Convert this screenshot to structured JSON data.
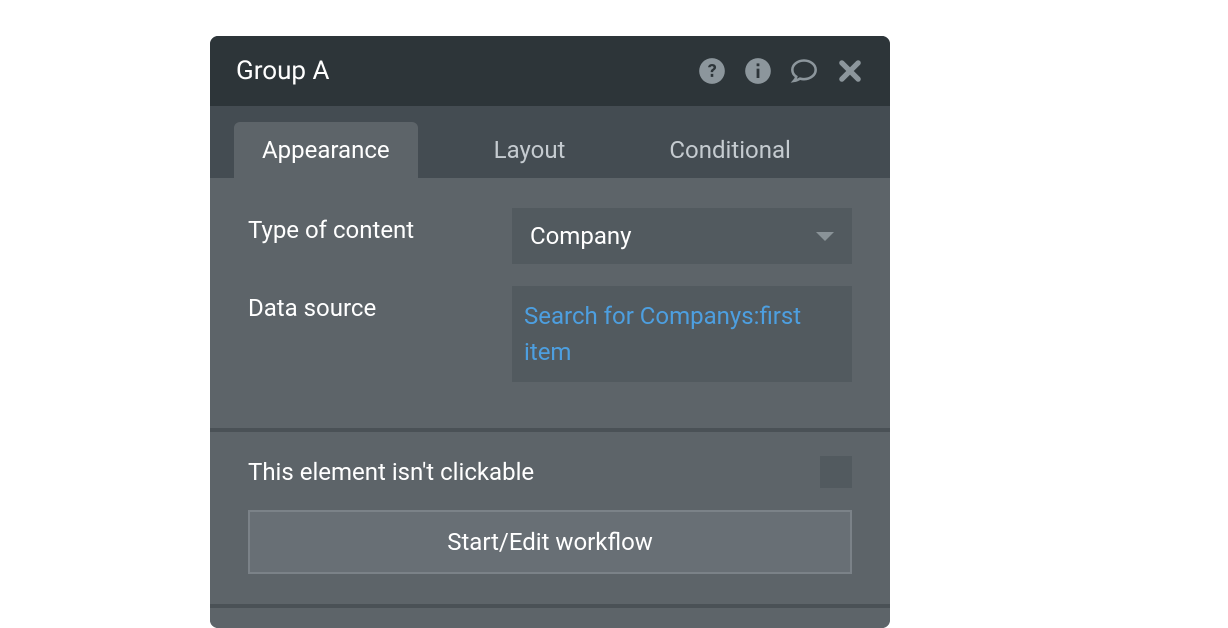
{
  "panel": {
    "title": "Group A"
  },
  "tabs": {
    "appearance": "Appearance",
    "layout": "Layout",
    "conditional": "Conditional"
  },
  "fields": {
    "typeOfContent": {
      "label": "Type of content",
      "value": "Company"
    },
    "dataSource": {
      "label": "Data source",
      "value": "Search for Companys:first item"
    }
  },
  "clickable": {
    "label": "This element isn't clickable"
  },
  "workflow": {
    "button": "Start/Edit workflow"
  }
}
